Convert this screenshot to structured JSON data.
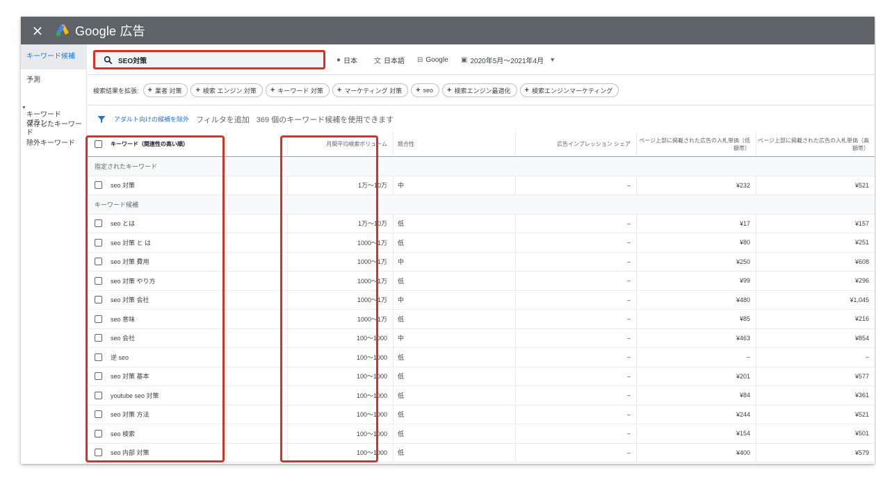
{
  "app": {
    "title": "Google 広告",
    "close_label": "×"
  },
  "icons": {
    "close": "close-icon",
    "logo": "google-ads-logo",
    "search": "search-icon",
    "location": "location-pin-icon",
    "language": "translate-icon",
    "network": "search-network-icon",
    "calendar": "calendar-icon",
    "dropdown": "chevron-down-icon",
    "filter": "filter-icon"
  },
  "colors": {
    "accent": "#1a73e8",
    "highlight": "#d93025",
    "topbar": "#5f6368"
  },
  "sidebar": {
    "items": [
      {
        "label": "キーワード候補",
        "active": true
      },
      {
        "label": "予測"
      },
      {
        "label": "キーワード\nプラン"
      },
      {
        "label": "保存したキーワード"
      },
      {
        "label": "除外キーワード"
      }
    ]
  },
  "search": {
    "value": "SEO対策",
    "location": "日本",
    "language": "日本語",
    "network": "Google",
    "date_range": "2020年5月〜2021年4月"
  },
  "expand": {
    "label": "検索結果を拡張:",
    "chips": [
      "業者 対策",
      "検索 エンジン 対策",
      "キーワード 対策",
      "マーケティング 対策",
      "seo",
      "検索エンジン最適化",
      "検索エンジンマーケティング"
    ]
  },
  "filter": {
    "exclude_adult": "アダルト向けの候補を除外",
    "add_filter": "フィルタを追加",
    "count_text": "369 個のキーワード候補を使用できます"
  },
  "table": {
    "headers": {
      "keyword": "キーワード（関連性の高い順）",
      "volume": "月間平均検索ボリューム",
      "competition": "競合性",
      "impression_share": "広告インプレッション シェア",
      "bid_low": "ページ上部に掲載された広告の入札単価（低額帯）",
      "bid_high": "ページ上部に掲載された広告の入札単価（高額帯）"
    },
    "groups": {
      "specified": "指定されたキーワード",
      "ideas": "キーワード候補"
    },
    "specified_rows": [
      {
        "keyword": "seo 対策",
        "volume": "1万～10万",
        "competition": "中",
        "impression": "–",
        "low": "¥232",
        "high": "¥521"
      }
    ],
    "idea_rows": [
      {
        "keyword": "seo とは",
        "volume": "1万～10万",
        "competition": "低",
        "impression": "–",
        "low": "¥17",
        "high": "¥157"
      },
      {
        "keyword": "seo 対策 と は",
        "volume": "1000～1万",
        "competition": "低",
        "impression": "–",
        "low": "¥80",
        "high": "¥251"
      },
      {
        "keyword": "seo 対策 費用",
        "volume": "1000～1万",
        "competition": "中",
        "impression": "–",
        "low": "¥250",
        "high": "¥608"
      },
      {
        "keyword": "seo 対策 やり方",
        "volume": "1000～1万",
        "competition": "低",
        "impression": "–",
        "low": "¥99",
        "high": "¥296"
      },
      {
        "keyword": "seo 対策 会社",
        "volume": "1000～1万",
        "competition": "中",
        "impression": "–",
        "low": "¥480",
        "high": "¥1,045"
      },
      {
        "keyword": "seo 意味",
        "volume": "1000～1万",
        "competition": "低",
        "impression": "–",
        "low": "¥85",
        "high": "¥216"
      },
      {
        "keyword": "seo 会社",
        "volume": "100～1000",
        "competition": "中",
        "impression": "–",
        "low": "¥463",
        "high": "¥854"
      },
      {
        "keyword": "逆 seo",
        "volume": "100～1000",
        "competition": "低",
        "impression": "–",
        "low": "–",
        "high": "–"
      },
      {
        "keyword": "seo 対策 基本",
        "volume": "100～1000",
        "competition": "低",
        "impression": "–",
        "low": "¥201",
        "high": "¥577"
      },
      {
        "keyword": "youtube seo 対策",
        "volume": "100～1000",
        "competition": "低",
        "impression": "–",
        "low": "¥84",
        "high": "¥361"
      },
      {
        "keyword": "seo 対策 方法",
        "volume": "100～1000",
        "competition": "低",
        "impression": "–",
        "low": "¥244",
        "high": "¥521"
      },
      {
        "keyword": "seo 検索",
        "volume": "100～1000",
        "competition": "低",
        "impression": "–",
        "low": "¥154",
        "high": "¥501"
      },
      {
        "keyword": "seo 内部 対策",
        "volume": "100～1000",
        "competition": "低",
        "impression": "–",
        "low": "¥400",
        "high": "¥579"
      }
    ]
  }
}
